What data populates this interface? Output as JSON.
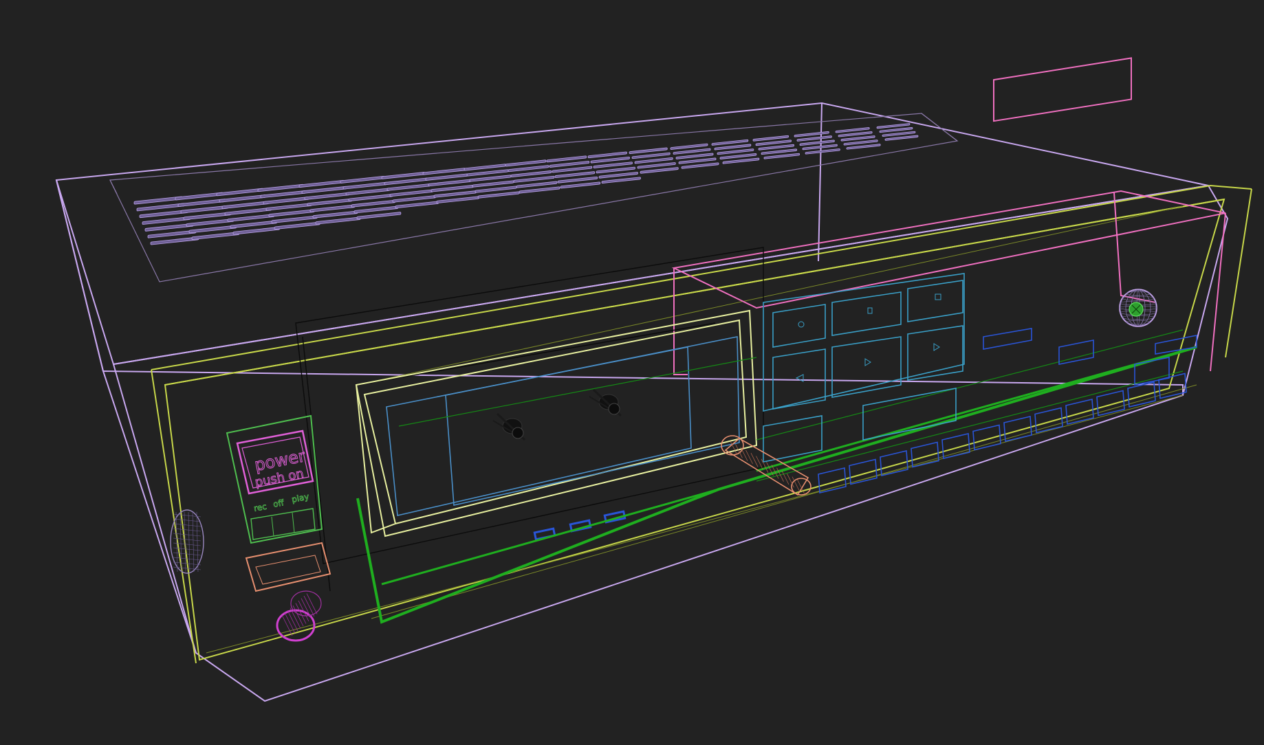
{
  "scene": {
    "background": "#222222",
    "palette": {
      "case": "#c9a8f0",
      "bezel": "#c8d84a",
      "power_switch": "#4fbf4f",
      "power_label": "#e060d8",
      "deck_frame": "#e8f0a0",
      "cassette_window": "#4a8fc8",
      "transport_keys": "#3aa0c8",
      "keys_blue": "#2a55d8",
      "rail": "#1fae1f",
      "knob_copper": "#e89070",
      "knob_magenta": "#d040d0",
      "pink_frame": "#f070c0",
      "reel_hub": "#111111",
      "vents": "#b8a0e8"
    },
    "labels": {
      "power_line1": "power",
      "power_line2": "push on",
      "mode_rec": "rec",
      "mode_off": "off",
      "mode_play": "play"
    }
  }
}
